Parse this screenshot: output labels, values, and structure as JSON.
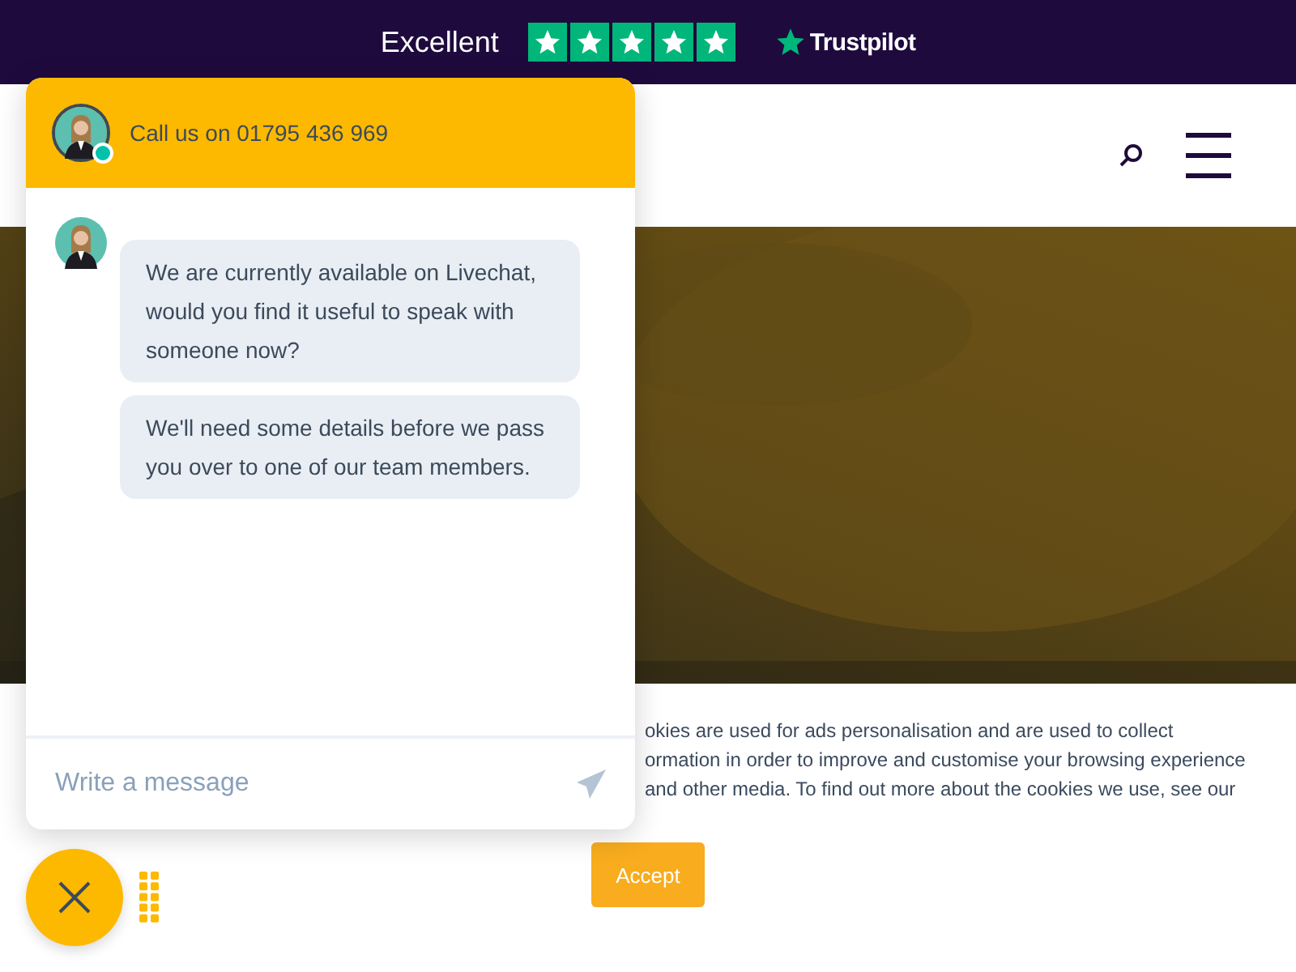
{
  "top_bar": {
    "rating_label": "Excellent",
    "stars": 5,
    "brand": "Trustpilot"
  },
  "chat": {
    "header": "Call us on 01795 436 969",
    "agent_online": true,
    "messages": [
      "We are currently available on Livechat, would you find it useful to speak with someone now?",
      "We'll need some details before we pass you over to one of our team members."
    ],
    "input": {
      "placeholder": "Write a message"
    }
  },
  "cookie_banner": {
    "lines": [
      "okies are used for ads personalisation and are used to collect",
      "ormation in order to improve and customise your browsing experience",
      "and other media. To find out more about the cookies we use, see our"
    ],
    "accept_button": "Accept"
  }
}
